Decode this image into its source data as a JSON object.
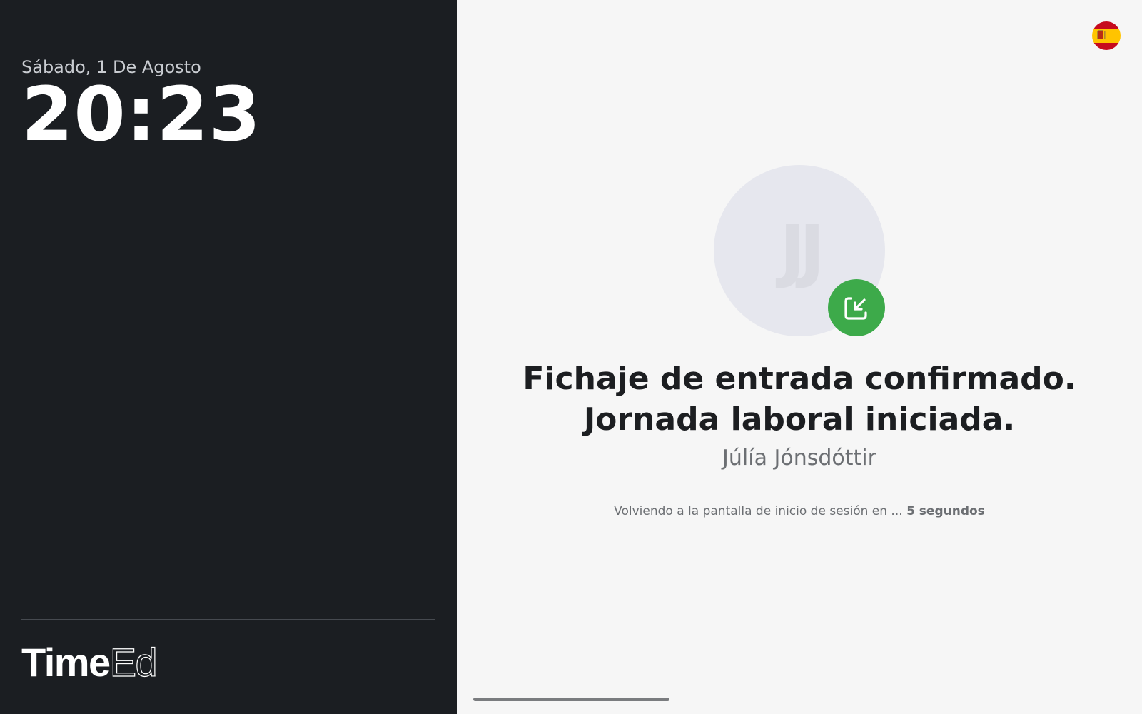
{
  "clock_panel": {
    "date": "Sábado, 1 De Agosto",
    "time": "20:23",
    "logo": {
      "bold_part": "Time",
      "light_part": "Ed"
    }
  },
  "language_flag": {
    "icon": "spain-flag-icon",
    "colors": {
      "red": "#c60b1e",
      "yellow": "#ffc400"
    }
  },
  "confirmation": {
    "avatar_initials": "JJ",
    "badge_icon": "clock-in-arrow-icon",
    "badge_color": "#3daa4a",
    "message": "Fichaje de entrada confirmado. Jornada laboral iniciada.",
    "user_name": "Júlía Jónsdóttir",
    "redirect_text": "Volviendo a la pantalla de inicio de sesión en ...",
    "countdown": "5 segundos"
  }
}
